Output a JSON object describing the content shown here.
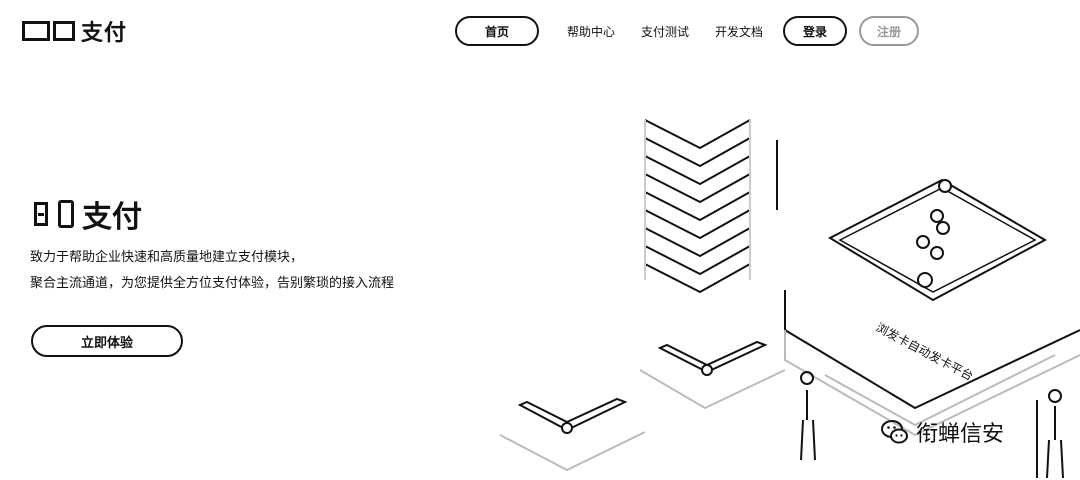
{
  "header": {
    "brand": "支付",
    "nav": {
      "home": "首页",
      "help": "帮助中心",
      "test": "支付测试",
      "docs": "开发文档",
      "login": "登录",
      "register": "注册"
    }
  },
  "hero": {
    "title": "支付",
    "line1": "致力于帮助企业快速和高质量地建立支付模块，",
    "line2": "聚合主流通道，为您提供全方位支付体验，告别繁琐的接入流程",
    "cta": "立即体验"
  },
  "illustration": {
    "platform_label": "浏发卡自动发卡平台"
  },
  "watermark": {
    "text": "衔蝉信安",
    "icon": "wechat-icon"
  }
}
